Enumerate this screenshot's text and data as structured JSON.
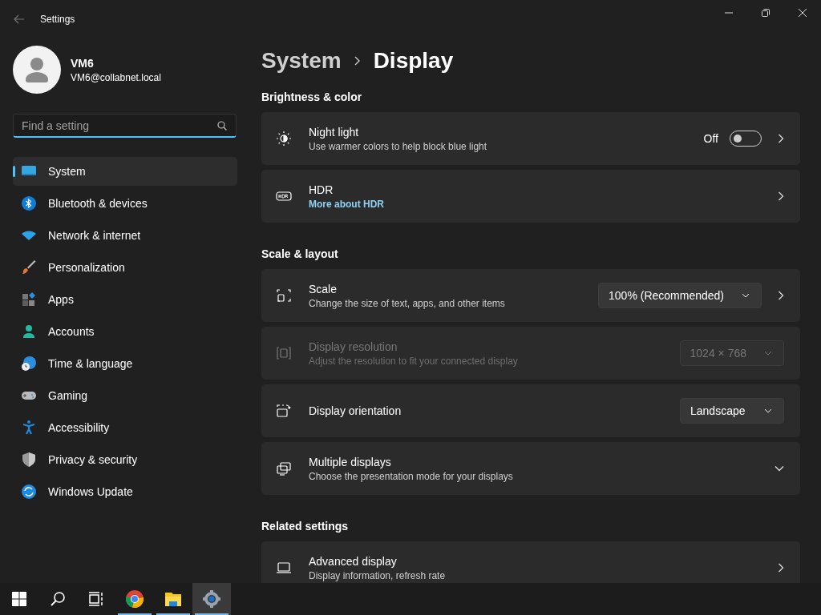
{
  "window": {
    "title": "Settings"
  },
  "user": {
    "name": "VM6",
    "email": "VM6@collabnet.local"
  },
  "search": {
    "placeholder": "Find a setting"
  },
  "nav": [
    {
      "label": "System",
      "kind": "system",
      "selected": true
    },
    {
      "label": "Bluetooth & devices",
      "kind": "bluetooth",
      "selected": false
    },
    {
      "label": "Network & internet",
      "kind": "network",
      "selected": false
    },
    {
      "label": "Personalization",
      "kind": "brush",
      "selected": false
    },
    {
      "label": "Apps",
      "kind": "apps",
      "selected": false
    },
    {
      "label": "Accounts",
      "kind": "accounts",
      "selected": false
    },
    {
      "label": "Time & language",
      "kind": "time",
      "selected": false
    },
    {
      "label": "Gaming",
      "kind": "gaming",
      "selected": false
    },
    {
      "label": "Accessibility",
      "kind": "accessibility",
      "selected": false
    },
    {
      "label": "Privacy & security",
      "kind": "privacy",
      "selected": false
    },
    {
      "label": "Windows Update",
      "kind": "update",
      "selected": false
    }
  ],
  "breadcrumb": [
    "System",
    "Display"
  ],
  "sections": [
    {
      "heading": "Brightness & color",
      "rows": [
        {
          "kind": "toggle",
          "title": "Night light",
          "subtitle": "Use warmer colors to help block blue light",
          "state_label": "Off",
          "on": false,
          "navigates": true,
          "expandable": false,
          "disabled": false
        },
        {
          "kind": "link",
          "title": "HDR",
          "link": "More about HDR",
          "navigates": true,
          "expandable": false,
          "disabled": false
        }
      ]
    },
    {
      "heading": "Scale & layout",
      "rows": [
        {
          "kind": "dropdown",
          "title": "Scale",
          "subtitle": "Change the size of text, apps, and other items",
          "value": "100% (Recommended)",
          "navigates": true,
          "expandable": false,
          "disabled": false
        },
        {
          "kind": "dropdown",
          "title": "Display resolution",
          "subtitle": "Adjust the resolution to fit your connected display",
          "value": "1024 × 768",
          "navigates": false,
          "expandable": false,
          "disabled": true
        },
        {
          "kind": "dropdown",
          "title": "Display orientation",
          "value": "Landscape",
          "navigates": false,
          "expandable": false,
          "disabled": false
        },
        {
          "kind": "plain",
          "title": "Multiple displays",
          "subtitle": "Choose the presentation mode for your displays",
          "navigates": false,
          "expandable": true,
          "disabled": false
        }
      ]
    },
    {
      "heading": "Related settings",
      "rows": [
        {
          "kind": "plain",
          "title": "Advanced display",
          "subtitle": "Display information, refresh rate",
          "navigates": true,
          "expandable": false,
          "disabled": false
        }
      ]
    }
  ],
  "taskbar": [
    {
      "kind": "start",
      "running": false,
      "selected": false
    },
    {
      "kind": "search",
      "running": false,
      "selected": false
    },
    {
      "kind": "taskview",
      "running": false,
      "selected": false
    },
    {
      "kind": "chrome",
      "running": true,
      "selected": false
    },
    {
      "kind": "explorer",
      "running": true,
      "selected": false
    },
    {
      "kind": "settings",
      "running": true,
      "selected": true
    }
  ]
}
